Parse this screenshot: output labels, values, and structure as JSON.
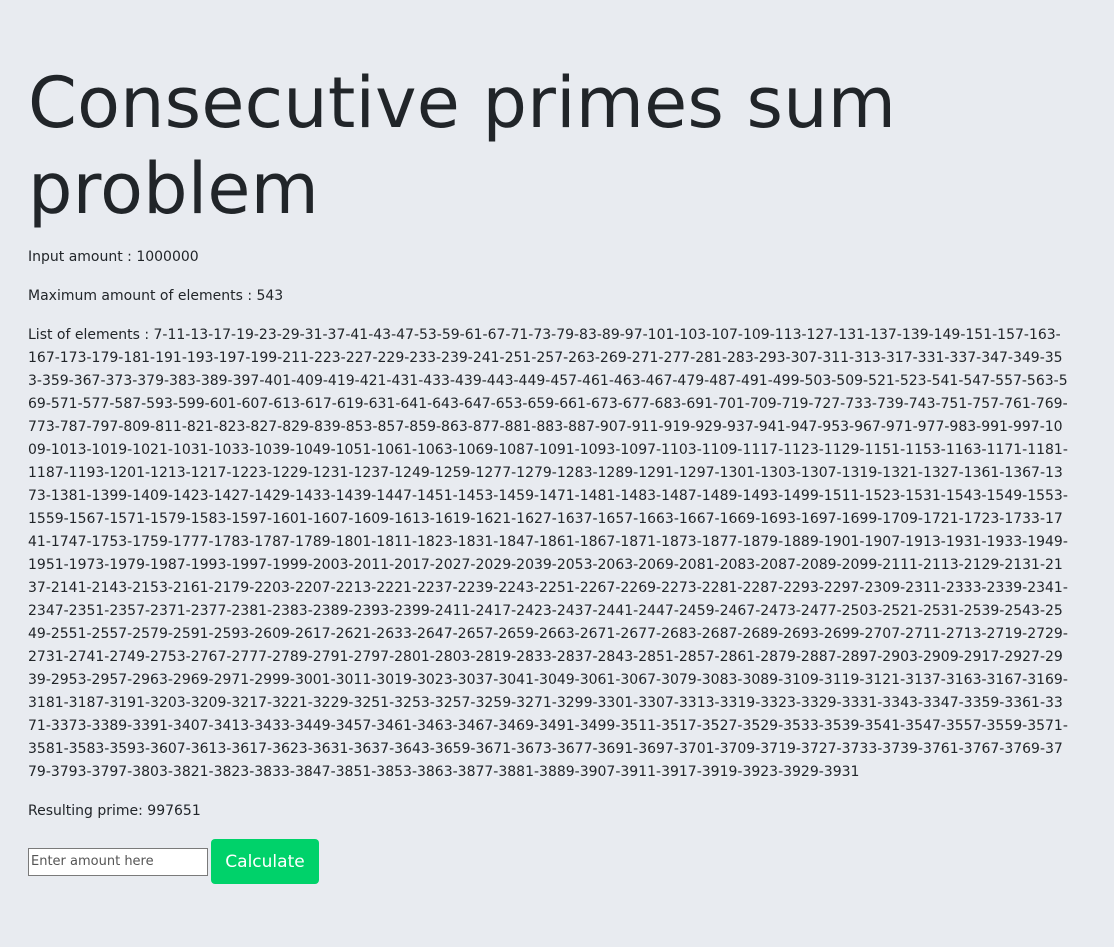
{
  "page": {
    "title": "Consecutive primes sum problem"
  },
  "info": {
    "input_amount": "Input amount : 1000000",
    "max_elements": "Maximum amount of elements : 543",
    "list_elements": "List of elements : 7-11-13-17-19-23-29-31-37-41-43-47-53-59-61-67-71-73-79-83-89-97-101-103-107-109-113-127-131-137-139-149-151-157-163-167-173-179-181-191-193-197-199-211-223-227-229-233-239-241-251-257-263-269-271-277-281-283-293-307-311-313-317-331-337-347-349-353-359-367-373-379-383-389-397-401-409-419-421-431-433-439-443-449-457-461-463-467-479-487-491-499-503-509-521-523-541-547-557-563-569-571-577-587-593-599-601-607-613-617-619-631-641-643-647-653-659-661-673-677-683-691-701-709-719-727-733-739-743-751-757-761-769-773-787-797-809-811-821-823-827-829-839-853-857-859-863-877-881-883-887-907-911-919-929-937-941-947-953-967-971-977-983-991-997-1009-1013-1019-1021-1031-1033-1039-1049-1051-1061-1063-1069-1087-1091-1093-1097-1103-1109-1117-1123-1129-1151-1153-1163-1171-1181-1187-1193-1201-1213-1217-1223-1229-1231-1237-1249-1259-1277-1279-1283-1289-1291-1297-1301-1303-1307-1319-1321-1327-1361-1367-1373-1381-1399-1409-1423-1427-1429-1433-1439-1447-1451-1453-1459-1471-1481-1483-1487-1489-1493-1499-1511-1523-1531-1543-1549-1553-1559-1567-1571-1579-1583-1597-1601-1607-1609-1613-1619-1621-1627-1637-1657-1663-1667-1669-1693-1697-1699-1709-1721-1723-1733-1741-1747-1753-1759-1777-1783-1787-1789-1801-1811-1823-1831-1847-1861-1867-1871-1873-1877-1879-1889-1901-1907-1913-1931-1933-1949-1951-1973-1979-1987-1993-1997-1999-2003-2011-2017-2027-2029-2039-2053-2063-2069-2081-2083-2087-2089-2099-2111-2113-2129-2131-2137-2141-2143-2153-2161-2179-2203-2207-2213-2221-2237-2239-2243-2251-2267-2269-2273-2281-2287-2293-2297-2309-2311-2333-2339-2341-2347-2351-2357-2371-2377-2381-2383-2389-2393-2399-2411-2417-2423-2437-2441-2447-2459-2467-2473-2477-2503-2521-2531-2539-2543-2549-2551-2557-2579-2591-2593-2609-2617-2621-2633-2647-2657-2659-2663-2671-2677-2683-2687-2689-2693-2699-2707-2711-2713-2719-2729-2731-2741-2749-2753-2767-2777-2789-2791-2797-2801-2803-2819-2833-2837-2843-2851-2857-2861-2879-2887-2897-2903-2909-2917-2927-2939-2953-2957-2963-2969-2971-2999-3001-3011-3019-3023-3037-3041-3049-3061-3067-3079-3083-3089-3109-3119-3121-3137-3163-3167-3169-3181-3187-3191-3203-3209-3217-3221-3229-3251-3253-3257-3259-3271-3299-3301-3307-3313-3319-3323-3329-3331-3343-3347-3359-3361-3371-3373-3389-3391-3407-3413-3433-3449-3457-3461-3463-3467-3469-3491-3499-3511-3517-3527-3529-3533-3539-3541-3547-3557-3559-3571-3581-3583-3593-3607-3613-3617-3623-3631-3637-3643-3659-3671-3673-3677-3691-3697-3701-3709-3719-3727-3733-3739-3761-3767-3769-3779-3793-3797-3803-3821-3823-3833-3847-3851-3853-3863-3877-3881-3889-3907-3911-3917-3919-3923-3929-3931",
    "result": "Resulting prime: 997651"
  },
  "form": {
    "placeholder": "Enter amount here",
    "value": "",
    "button_label": "Calculate"
  },
  "colors": {
    "background": "#e8ebf0",
    "button": "#00d26a",
    "text": "#212529"
  }
}
